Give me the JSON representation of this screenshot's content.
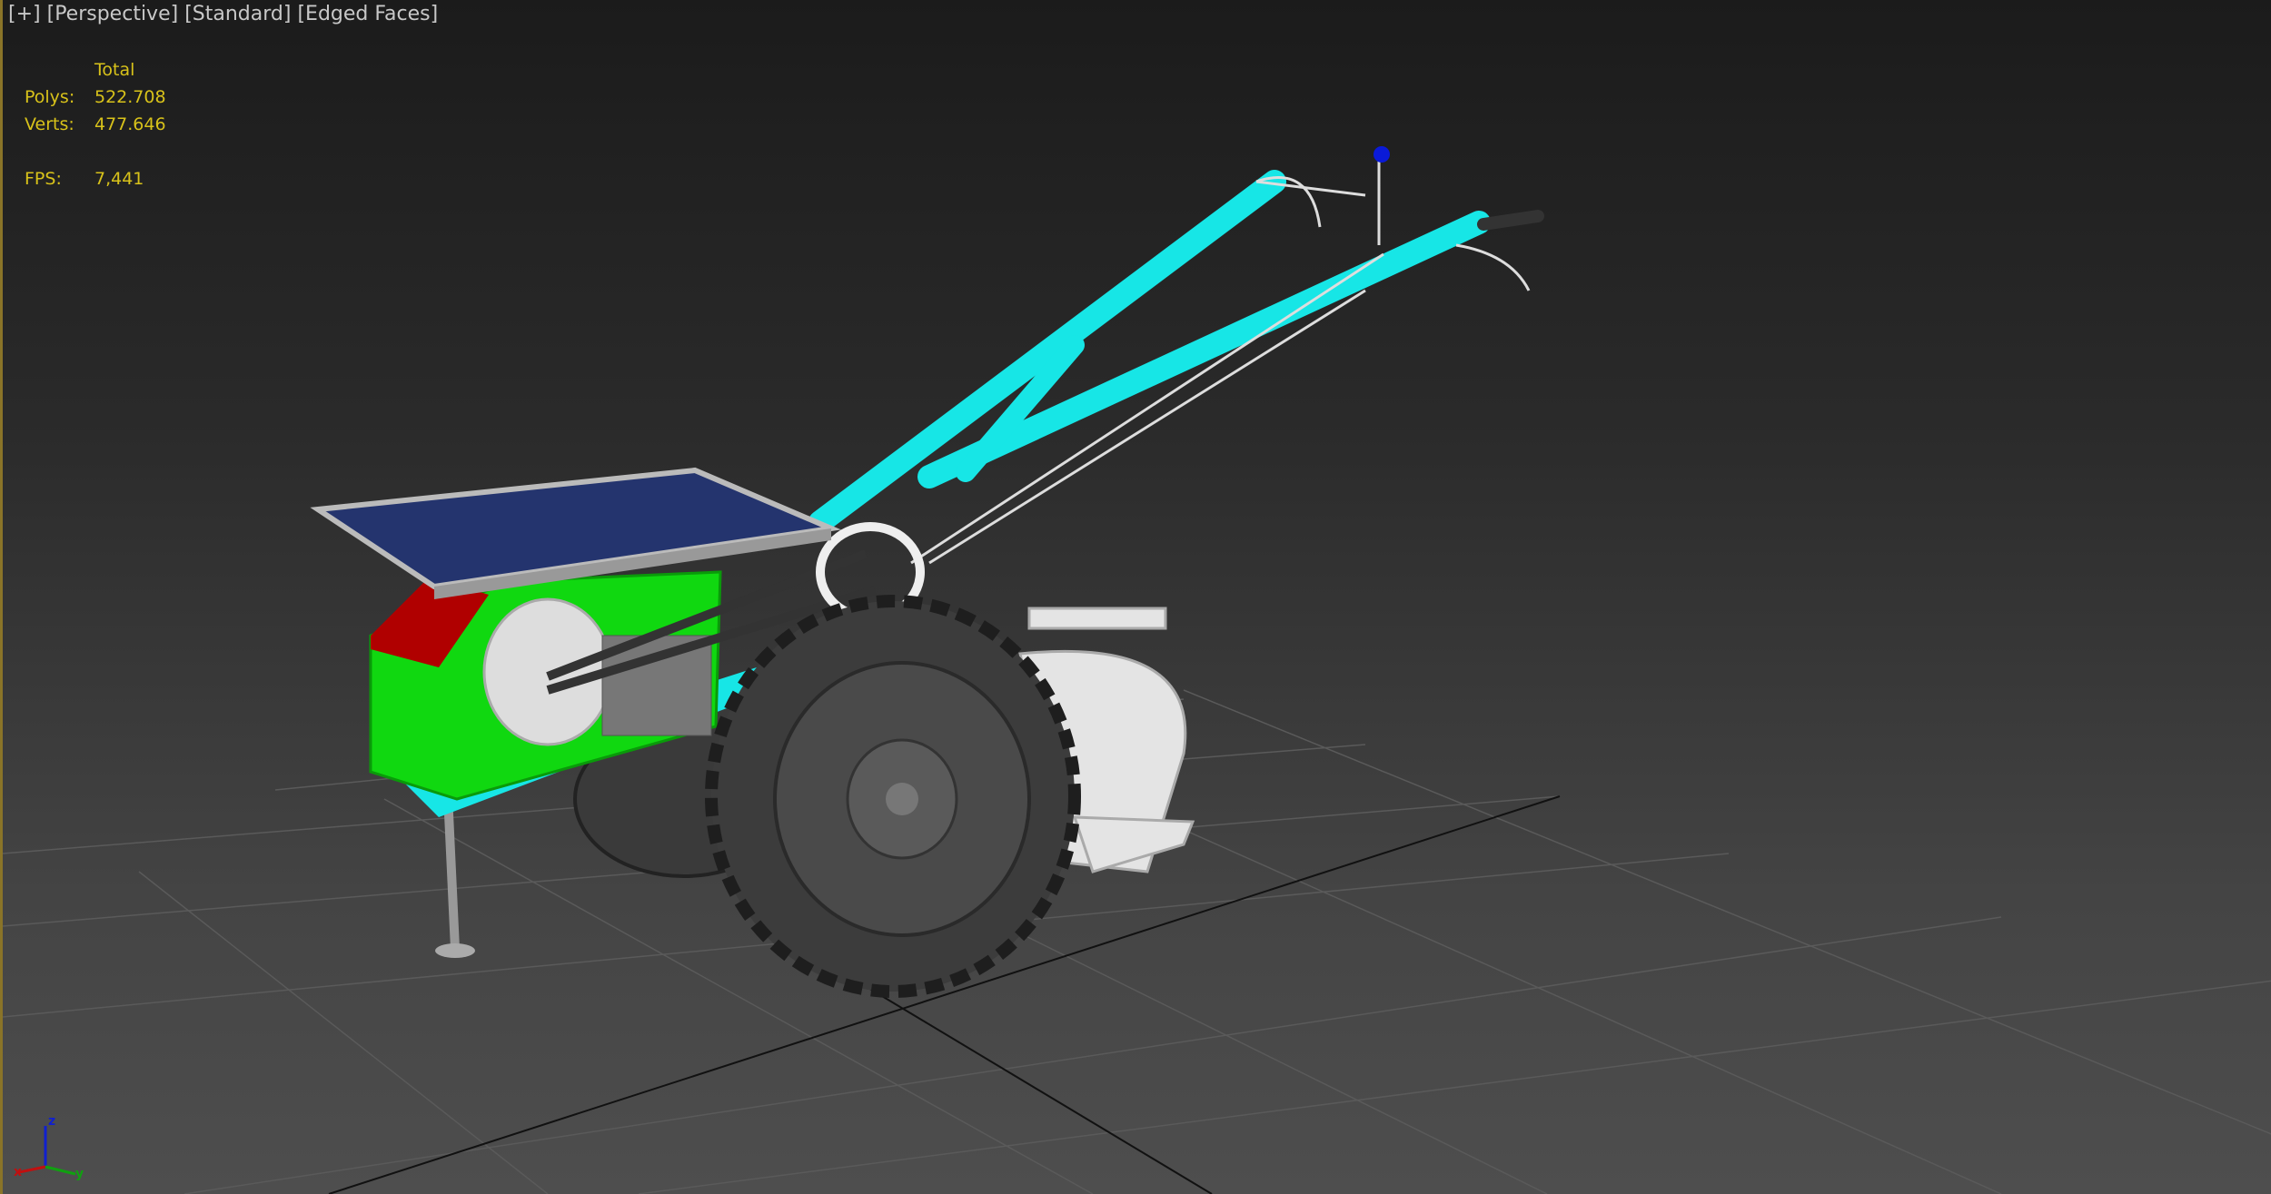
{
  "viewport": {
    "labels": [
      "[+]",
      "[Perspective]",
      "[Standard]",
      "[Edged Faces]"
    ],
    "stats": {
      "header": "Total",
      "rows": [
        {
          "label": "Polys:",
          "value": "522.708"
        },
        {
          "label": "Verts:",
          "value": "477.646"
        }
      ],
      "fps_label": "FPS:",
      "fps_value": "7,441"
    },
    "axis_gizmo": {
      "x": "x",
      "y": "y",
      "z": "z"
    }
  },
  "colors": {
    "stats_text": "#d8c21a",
    "label_text": "#c8c8c8",
    "frame": "#cfe000",
    "cyan": "#17e6e6",
    "green": "#10d810",
    "red": "#b00000"
  }
}
